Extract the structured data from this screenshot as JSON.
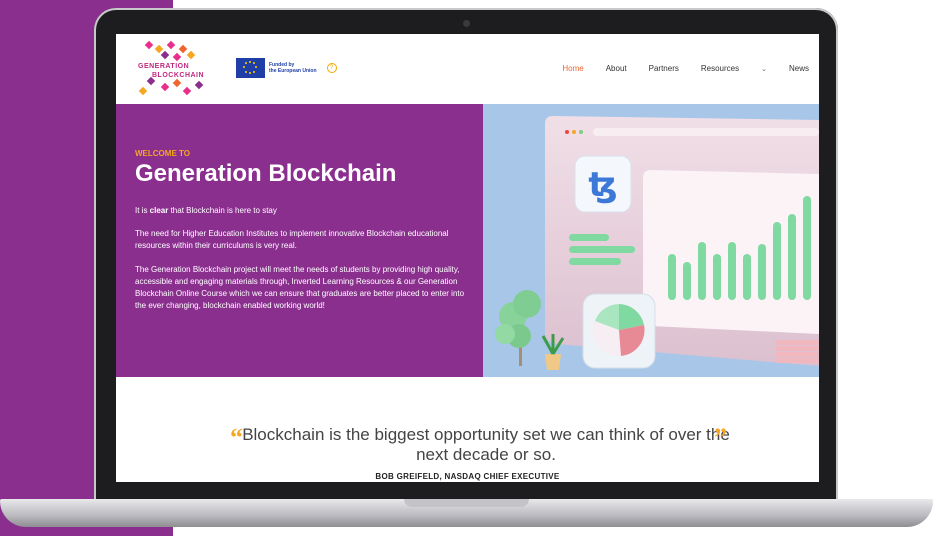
{
  "colors": {
    "brand_purple": "#8b2f8f",
    "accent_orange": "#f5a623",
    "nav_active": "#f0652f",
    "eu_blue": "#1f3fa6"
  },
  "logo": {
    "line1": "GENERATION",
    "line2": "BLOCKCHAIN"
  },
  "eu_badge": {
    "line1": "Funded by",
    "line2": "the European Union",
    "help_icon": "?"
  },
  "nav": {
    "items": [
      {
        "label": "Home",
        "active": true
      },
      {
        "label": "About",
        "active": false
      },
      {
        "label": "Partners",
        "active": false
      },
      {
        "label": "Resources",
        "active": false,
        "dropdown": true
      },
      {
        "label": "News",
        "active": false
      }
    ],
    "dropdown_icon": "chevron-down-icon"
  },
  "hero": {
    "eyebrow": "WELCOME TO",
    "title": "Generation Blockchain",
    "p1_prefix": "It is ",
    "p1_bold": "clear",
    "p1_suffix": " that Blockchain is here to stay",
    "p2": "The need for Higher Education Institutes to implement innovative Blockchain educational resources within their curriculums is very real.",
    "p3": "The Generation Blockchain project will meet the needs of students by providing high quality, accessible and engaging materials through, Inverted Learning Resources & our Generation Blockchain Online Course which we can ensure that graduates are better placed to enter into the ever changing, blockchain enabled working world!",
    "illustration_icon": "tezos-icon"
  },
  "quote": {
    "open_mark": "“",
    "close_mark": "”",
    "text": "Blockchain is the biggest opportunity set we can think of over the next decade or so.",
    "author": "BOB GREIFELD, NASDAQ CHIEF EXECUTIVE"
  }
}
